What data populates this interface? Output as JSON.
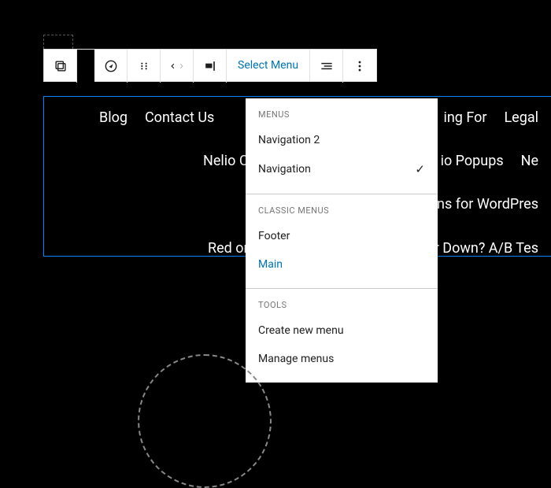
{
  "toolbar": {
    "select_label": "Select Menu"
  },
  "nav": {
    "row1": [
      "Blog",
      "Contact Us"
    ],
    "row1b": [
      "ing For",
      "Legal"
    ],
    "row2a": "Nelio C",
    "row2b": [
      "io Popups",
      "Ne"
    ],
    "row3b": "ns for WordPres",
    "row4a": "Red or",
    "row4b": "r Down? A/B Tes"
  },
  "dropdown": {
    "sections": [
      {
        "heading": "MENUS",
        "items": [
          {
            "label": "Navigation 2",
            "checked": false
          },
          {
            "label": "Navigation",
            "checked": true
          }
        ]
      },
      {
        "heading": "CLASSIC MENUS",
        "items": [
          {
            "label": "Footer"
          },
          {
            "label": "Main",
            "highlight": true
          }
        ]
      },
      {
        "heading": "TOOLS",
        "items": [
          {
            "label": "Create new menu"
          },
          {
            "label": "Manage menus"
          }
        ]
      }
    ]
  }
}
